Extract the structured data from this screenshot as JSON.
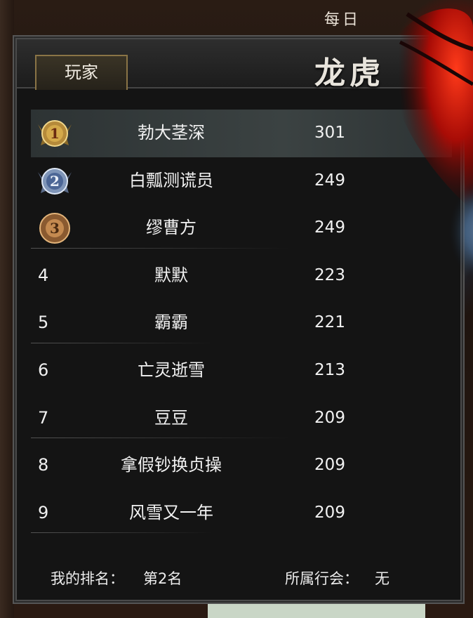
{
  "header": {
    "daily_text": "每日",
    "tab_label": "玩家",
    "title": "龙虎"
  },
  "ranking": [
    {
      "rank": "1",
      "name": "勃大茎深",
      "score": "301"
    },
    {
      "rank": "2",
      "name": "白瓢测谎员",
      "score": "249"
    },
    {
      "rank": "3",
      "name": "缪曹方",
      "score": "249"
    },
    {
      "rank": "4",
      "name": "默默",
      "score": "223"
    },
    {
      "rank": "5",
      "name": "霸霸",
      "score": "221"
    },
    {
      "rank": "6",
      "name": "亡灵逝雪",
      "score": "213"
    },
    {
      "rank": "7",
      "name": "豆豆",
      "score": "209"
    },
    {
      "rank": "8",
      "name": "拿假钞换贞操",
      "score": "209"
    },
    {
      "rank": "9",
      "name": "风雪又一年",
      "score": "209"
    }
  ],
  "footer": {
    "my_rank_label": "我的排名：",
    "my_rank_value": "第2名",
    "guild_label": "所属行会：",
    "guild_value": "无"
  },
  "colors": {
    "gold": "#c9a24a",
    "silver": "#8ea6c8",
    "bronze": "#c48a50",
    "accent_red": "#b8140a"
  }
}
